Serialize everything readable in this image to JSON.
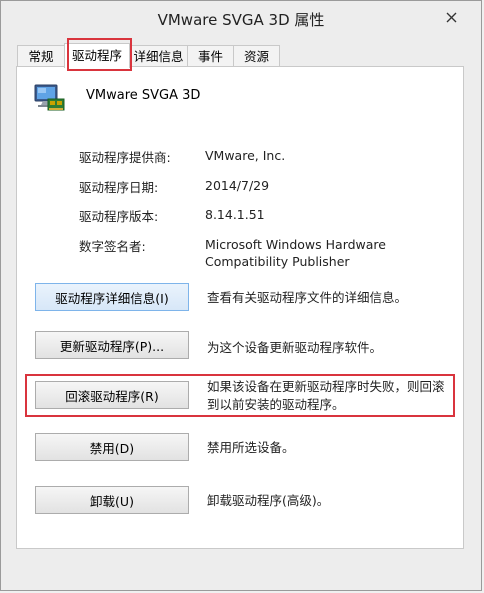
{
  "window": {
    "title": "VMware SVGA 3D 属性"
  },
  "tabs": [
    {
      "label": "常规"
    },
    {
      "label": "驱动程序"
    },
    {
      "label": "详细信息"
    },
    {
      "label": "事件"
    },
    {
      "label": "资源"
    }
  ],
  "device": {
    "name": "VMware SVGA 3D"
  },
  "props": [
    {
      "label": "驱动程序提供商:",
      "value": "VMware, Inc."
    },
    {
      "label": "驱动程序日期:",
      "value": "2014/7/29"
    },
    {
      "label": "驱动程序版本:",
      "value": "8.14.1.51"
    },
    {
      "label": "数字签名者:",
      "value": "Microsoft Windows Hardware Compatibility Publisher"
    }
  ],
  "actions": [
    {
      "button": "驱动程序详细信息(I)",
      "desc": "查看有关驱动程序文件的详细信息。"
    },
    {
      "button": "更新驱动程序(P)...",
      "desc": "为这个设备更新驱动程序软件。"
    },
    {
      "button": "回滚驱动程序(R)",
      "desc": "如果该设备在更新驱动程序时失败，则回滚到以前安装的驱动程序。"
    },
    {
      "button": "禁用(D)",
      "desc": "禁用所选设备。"
    },
    {
      "button": "卸载(U)",
      "desc": "卸载驱动程序(高级)。"
    }
  ],
  "colors": {
    "highlight": "#d9343d",
    "focus_border": "#7eb4ea"
  }
}
